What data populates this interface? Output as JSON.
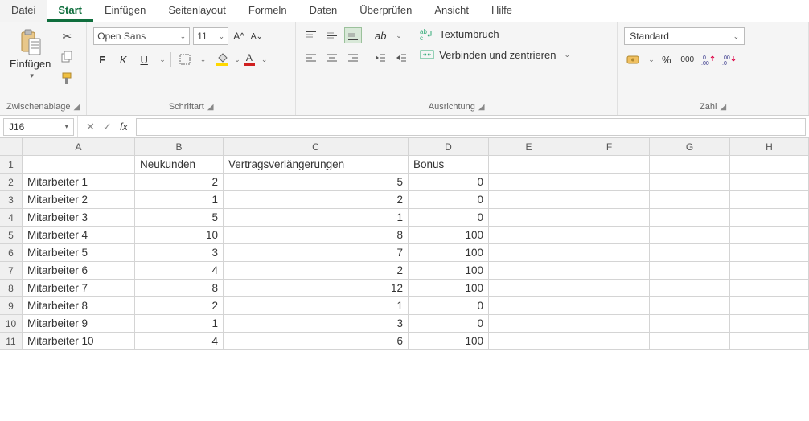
{
  "tabs": {
    "file": "Datei",
    "home": "Start",
    "insert": "Einfügen",
    "pagelayout": "Seitenlayout",
    "formulas": "Formeln",
    "data": "Daten",
    "review": "Überprüfen",
    "view": "Ansicht",
    "help": "Hilfe"
  },
  "ribbon": {
    "clipboard": {
      "paste": "Einfügen",
      "label": "Zwischenablage"
    },
    "font": {
      "name": "Open Sans",
      "size": "11",
      "bold": "F",
      "italic": "K",
      "underline": "U",
      "label": "Schriftart"
    },
    "align": {
      "wrap": "Textumbruch",
      "merge": "Verbinden und zentrieren",
      "label": "Ausrichtung"
    },
    "number": {
      "format": "Standard",
      "percent": "%",
      "thousands": "000",
      "label": "Zahl"
    }
  },
  "formula_bar": {
    "cell_ref": "J16",
    "fx": "fx",
    "value": ""
  },
  "columns": [
    "A",
    "B",
    "C",
    "D",
    "E",
    "F",
    "G",
    "H"
  ],
  "row_numbers": [
    "1",
    "2",
    "3",
    "4",
    "5",
    "6",
    "7",
    "8",
    "9",
    "10",
    "11"
  ],
  "headers": {
    "b": "Neukunden",
    "c": "Vertragsverlängerungen",
    "d": "Bonus"
  },
  "rows": [
    {
      "a": "Mitarbeiter 1",
      "b": "2",
      "c": "5",
      "d": "0"
    },
    {
      "a": "Mitarbeiter 2",
      "b": "1",
      "c": "2",
      "d": "0"
    },
    {
      "a": "Mitarbeiter 3",
      "b": "5",
      "c": "1",
      "d": "0"
    },
    {
      "a": "Mitarbeiter 4",
      "b": "10",
      "c": "8",
      "d": "100"
    },
    {
      "a": "Mitarbeiter 5",
      "b": "3",
      "c": "7",
      "d": "100"
    },
    {
      "a": "Mitarbeiter 6",
      "b": "4",
      "c": "2",
      "d": "100"
    },
    {
      "a": "Mitarbeiter 7",
      "b": "8",
      "c": "12",
      "d": "100"
    },
    {
      "a": "Mitarbeiter 8",
      "b": "2",
      "c": "1",
      "d": "0"
    },
    {
      "a": "Mitarbeiter 9",
      "b": "1",
      "c": "3",
      "d": "0"
    },
    {
      "a": "Mitarbeiter 10",
      "b": "4",
      "c": "6",
      "d": "100"
    }
  ]
}
